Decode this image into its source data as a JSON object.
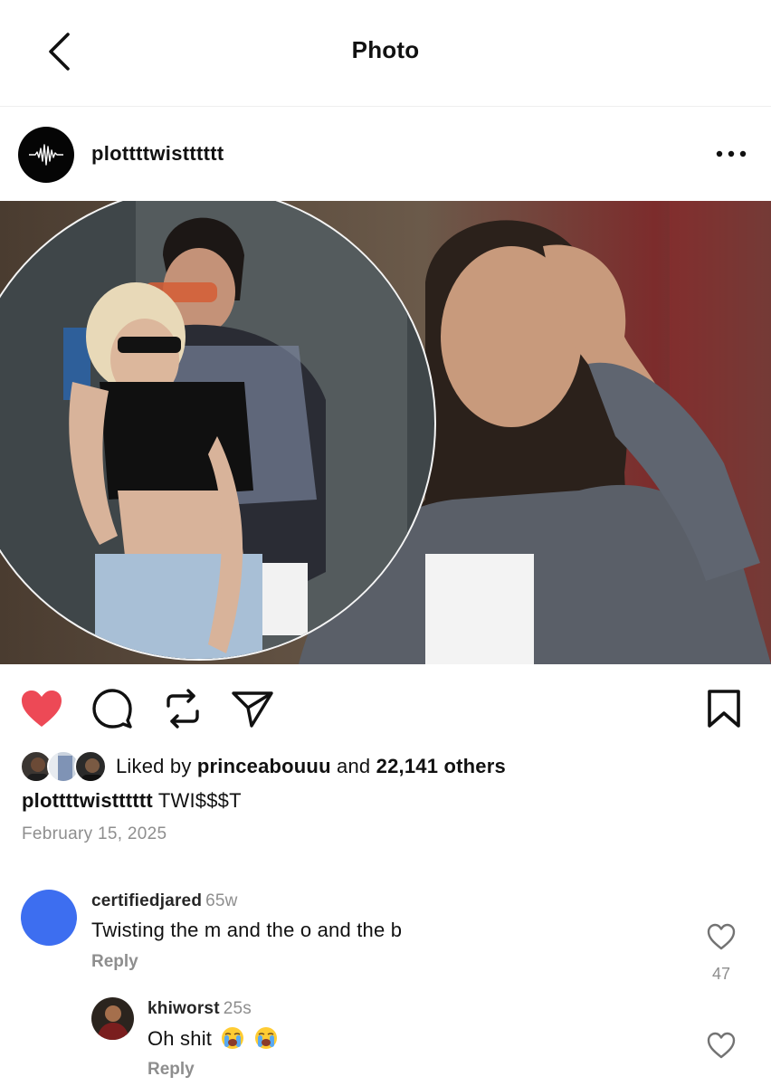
{
  "header": {
    "title": "Photo",
    "back_icon": "chevron-left-icon"
  },
  "post": {
    "author": "plottttwistttttt",
    "avatar_icon": "waveform-icon",
    "more_icon": "more-horizontal-icon",
    "image_description_icon": "post-photo",
    "liked_by_prefix": "Liked by",
    "liked_by_user": "princeabouuu",
    "liked_by_connector": "and",
    "liked_by_others": "22,141 others",
    "caption_user": "plottttwistttttt",
    "caption_text": "TWI$$$T",
    "date": "February 15, 2025"
  },
  "actions": {
    "like_icon": "heart-filled-icon",
    "comment_icon": "comment-icon",
    "repost_icon": "repost-icon",
    "share_icon": "send-icon",
    "save_icon": "bookmark-icon",
    "like_color": "#ed4956"
  },
  "comments": [
    {
      "user": "certifiedjared",
      "time": "65w",
      "text": "Twisting the m and the o and the b",
      "reply_label": "Reply",
      "like_count": "47",
      "avatar_color": "#3d6ef0"
    },
    {
      "user": "khiworst",
      "time": "25s",
      "text": "Oh shit",
      "emoji": "crying-face-emoji",
      "reply_label": "Reply"
    }
  ]
}
